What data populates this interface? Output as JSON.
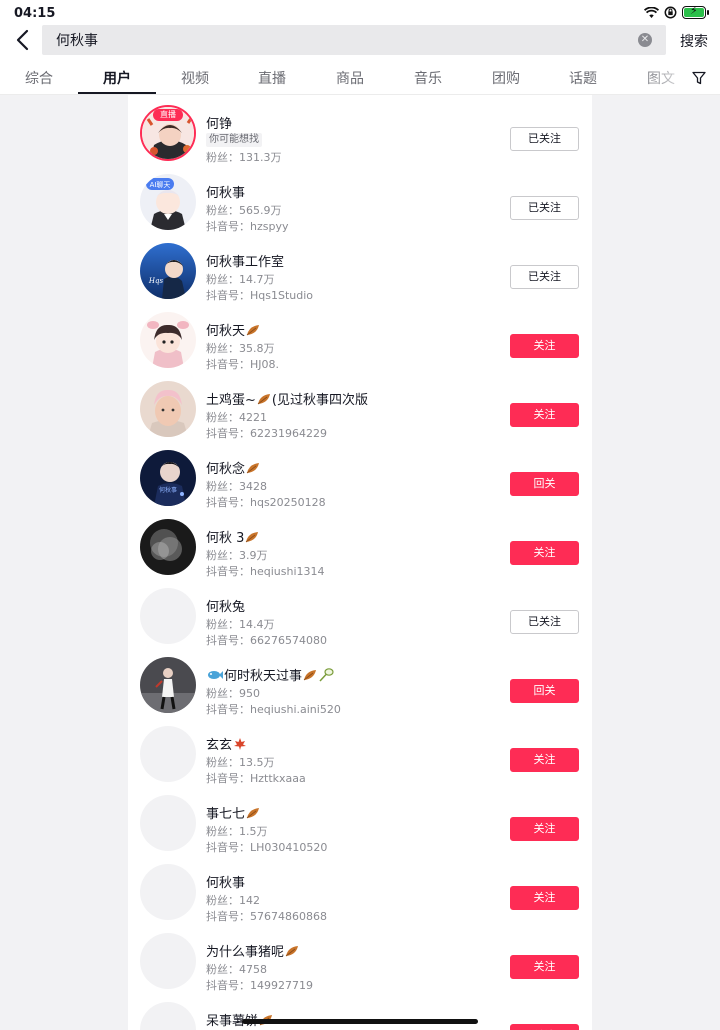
{
  "status": {
    "time": "04:15"
  },
  "search": {
    "query": "何秋事",
    "button": "搜索"
  },
  "tabs": [
    "综合",
    "用户",
    "视频",
    "直播",
    "商品",
    "音乐",
    "团购",
    "话题",
    "图文"
  ],
  "live_badge": "直播",
  "colors": {
    "accent": "#fe2c55",
    "text": "#161823",
    "muted": "#8a8b91"
  },
  "users": [
    {
      "name": "何铮",
      "tagline": "你可能想找",
      "fans": "粉丝：131.3万",
      "id": "",
      "button": "已关注",
      "followed": true,
      "live": true,
      "avatar": "avatar-1"
    },
    {
      "name": "何秋事",
      "fans": "粉丝：565.9万",
      "id": "抖音号：hzspyy",
      "button": "已关注",
      "followed": true,
      "avatar": "avatar-2"
    },
    {
      "name": "何秋事工作室",
      "fans": "粉丝：14.7万",
      "id": "抖音号：Hqs1Studio",
      "button": "已关注",
      "followed": true,
      "avatar": "avatar-3"
    },
    {
      "name": "何秋天",
      "fans": "粉丝：35.8万",
      "id": "抖音号：HJ08.",
      "button": "关注",
      "followed": false,
      "leaf": true,
      "avatar": "avatar-4"
    },
    {
      "name": "土鸡蛋~",
      "name_suffix": "(见过秋事四次版",
      "fans": "粉丝：4221",
      "id": "抖音号：62231964229",
      "button": "关注",
      "followed": false,
      "leaf": true,
      "avatar": "avatar-5"
    },
    {
      "name": "何秋念",
      "fans": "粉丝：3428",
      "id": "抖音号：hqs20250128",
      "button": "回关",
      "followed": false,
      "leaf": true,
      "avatar": "avatar-6"
    },
    {
      "name": "何秋 3",
      "fans": "粉丝：3.9万",
      "id": "抖音号：heqiushi1314",
      "button": "关注",
      "followed": false,
      "leaf": true,
      "avatar": "avatar-7"
    },
    {
      "name": "何秋兔",
      "fans": "粉丝：14.4万",
      "id": "抖音号：66276574080",
      "button": "已关注",
      "followed": true,
      "avatar": "avatar-placeholder"
    },
    {
      "name": "何时秋天过事",
      "fans": "粉丝：950",
      "id": "抖音号：heqiushi.aini520",
      "button": "回关",
      "followed": false,
      "leaf": true,
      "fish": true,
      "racket": true,
      "avatar": "avatar-9"
    },
    {
      "name": "玄玄",
      "fans": "粉丝：13.5万",
      "id": "抖音号：Hzttkxaaa",
      "button": "关注",
      "followed": false,
      "maple": true,
      "avatar": "avatar-placeholder"
    },
    {
      "name": "事七七",
      "fans": "粉丝：1.5万",
      "id": "抖音号：LH030410520",
      "button": "关注",
      "followed": false,
      "leaf": true,
      "avatar": "avatar-placeholder"
    },
    {
      "name": "何秋事",
      "fans": "粉丝：142",
      "id": "抖音号：57674860868",
      "button": "关注",
      "followed": false,
      "avatar": "avatar-placeholder"
    },
    {
      "name": "为什么事猪呢",
      "fans": "粉丝：4758",
      "id": "抖音号：149927719",
      "button": "关注",
      "followed": false,
      "leaf": true,
      "avatar": "avatar-placeholder"
    },
    {
      "name": "呆事薯饼",
      "fans": "",
      "id": "",
      "button": "关注",
      "followed": false,
      "leaf": true,
      "avatar": "avatar-placeholder"
    }
  ]
}
